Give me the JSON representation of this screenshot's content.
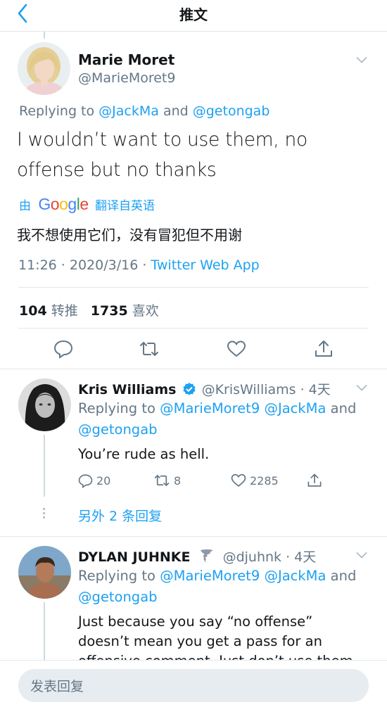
{
  "header": {
    "title": "推文",
    "back_icon": "chevron-left-icon"
  },
  "main_tweet": {
    "name": "Marie Moret",
    "handle": "@MarieMoret9",
    "replying_prefix": "Replying to",
    "replying_user1": "@JackMa",
    "replying_and": "and",
    "replying_user2": "@getongab",
    "text": "I wouldn’t want to use them, no offense but no thanks",
    "translate_by": "由",
    "translate_brand": "Google",
    "translate_from": "翻译自英语",
    "translation": "我不想使用它们，没有冒犯但不用谢",
    "time": "11:26 · 2020/3/16 ·",
    "source": "Twitter Web App",
    "retweets_count": "104",
    "retweets_label": "转推",
    "likes_count": "1735",
    "likes_label": "喜欢"
  },
  "replies": [
    {
      "name": "Kris Williams",
      "handle": "@KrisWilliams",
      "time": "· 4天",
      "verified": true,
      "replying_prefix": "Replying to",
      "replying_user1": "@MarieMoret9",
      "replying_user2": "@JackMa",
      "replying_and": "and",
      "replying_user3": "@getongab",
      "text": "You’re rude as hell.",
      "reply_count": "20",
      "retweet_count": "8",
      "like_count": "2285"
    },
    {
      "name": "DYLAN JUHNKE",
      "handle": "@djuhnk",
      "time": "· 4天",
      "badge_icon": "tornado-emoji-icon",
      "replying_prefix": "Replying to",
      "replying_user1": "@MarieMoret9",
      "replying_user2": "@JackMa",
      "replying_and": "and",
      "replying_user3": "@getongab",
      "text_line1": "Just because you say “no offense”",
      "text_line2": "doesn’t mean you get a pass for an",
      "text_line3": "offensive comment. Just don’t use them."
    }
  ],
  "more_replies": {
    "label": "另外 2 条回复"
  },
  "composer": {
    "placeholder": "发表回复"
  },
  "colors": {
    "accent": "#1da1f2",
    "secondary_text": "#657786",
    "divider": "#e1e8ed"
  }
}
